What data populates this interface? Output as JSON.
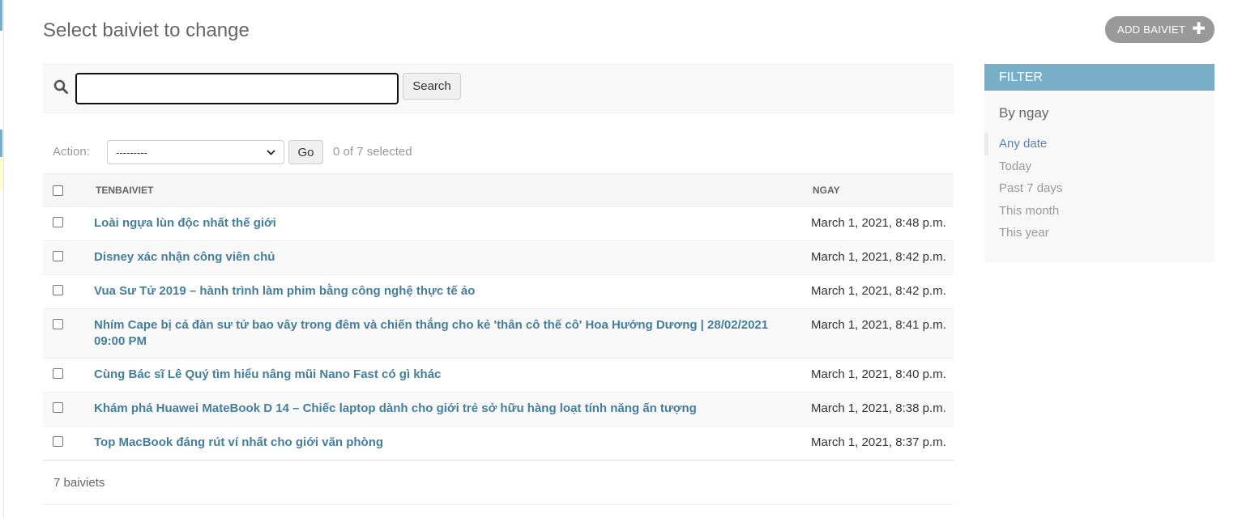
{
  "page": {
    "title": "Select baiviet to change"
  },
  "toolbar": {
    "add_label": "ADD BAIVIET"
  },
  "search": {
    "value": "",
    "button_label": "Search"
  },
  "actions": {
    "label": "Action:",
    "selected_option": "---------",
    "go_label": "Go",
    "selected_count": "0 of 7 selected"
  },
  "table": {
    "columns": [
      "TENBAIVIET",
      "NGAY"
    ],
    "rows": [
      {
        "title": "Loài ngựa lùn độc nhất thế giới",
        "date": "March 1, 2021, 8:48 p.m."
      },
      {
        "title": "Disney xác nhận công viên chủ",
        "date": "March 1, 2021, 8:42 p.m."
      },
      {
        "title": "Vua Sư Tử 2019 – hành trình làm phim bằng công nghệ thực tế ảo",
        "date": "March 1, 2021, 8:42 p.m."
      },
      {
        "title": "Nhím Cape bị cả đàn sư tử bao vây trong đêm và chiến thắng cho kẻ 'thân cô thế cô' Hoa Hướng Dương | 28/02/2021 09:00 PM",
        "date": "March 1, 2021, 8:41 p.m."
      },
      {
        "title": "Cùng Bác sĩ Lê Quý tìm hiểu nâng mũi Nano Fast có gì khác",
        "date": "March 1, 2021, 8:40 p.m."
      },
      {
        "title": "Khám phá Huawei MateBook D 14 – Chiếc laptop dành cho giới trẻ sở hữu hàng loạt tính năng ấn tượng",
        "date": "March 1, 2021, 8:38 p.m."
      },
      {
        "title": "Top MacBook đáng rút ví nhất cho giới văn phòng",
        "date": "March 1, 2021, 8:37 p.m."
      }
    ]
  },
  "paginator": {
    "text": "7 baiviets"
  },
  "filter": {
    "header": "FILTER",
    "group_title": "By ngay",
    "options": [
      "Any date",
      "Today",
      "Past 7 days",
      "This month",
      "This year"
    ],
    "selected": "Any date"
  },
  "colors": {
    "accent": "#79aec8",
    "link": "#447e9b",
    "add_button": "#999999"
  },
  "icons": {
    "search": "search-icon",
    "add": "plus-icon",
    "select": "chevron-down-icon"
  }
}
